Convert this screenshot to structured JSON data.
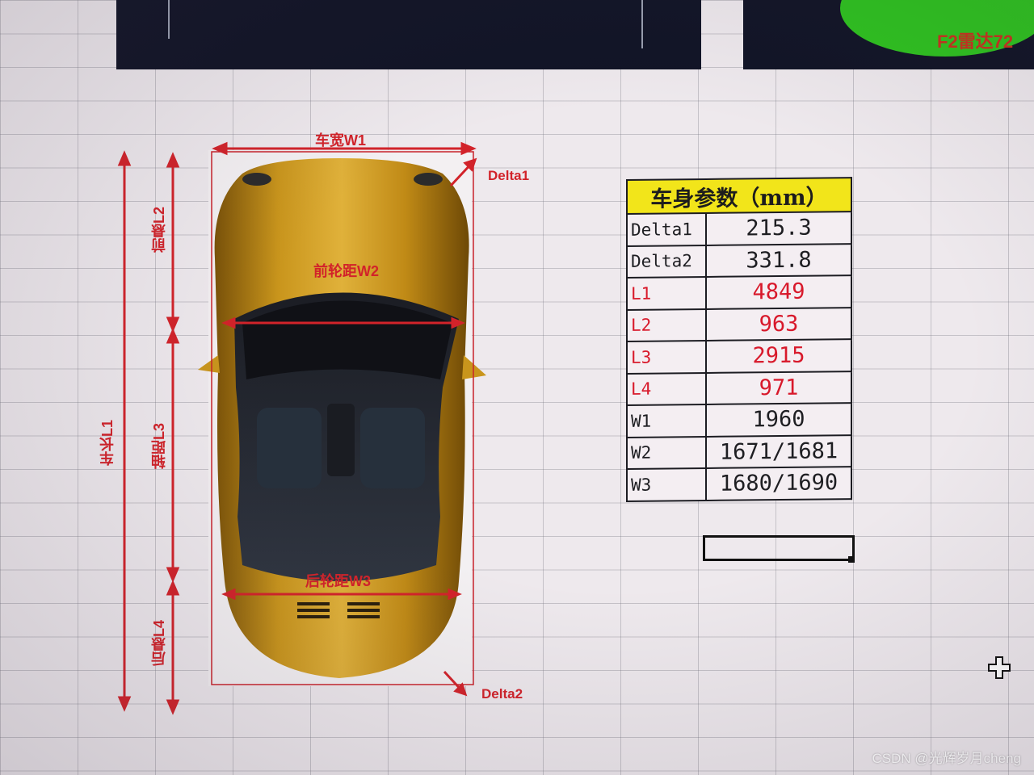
{
  "top_panels": {
    "radar_label": "F2雷达72"
  },
  "car_diagram": {
    "width_label": "车宽W1",
    "front_track_label": "前轮距W2",
    "rear_track_label": "后轮距W3",
    "length_label": "车长L1",
    "front_overhang_label": "前悬L2",
    "wheelbase_label": "轴距L3",
    "rear_overhang_label": "后悬L4",
    "delta1_label": "Delta1",
    "delta2_label": "Delta2"
  },
  "params_table": {
    "header": "车身参数（mm）",
    "rows": [
      {
        "name": "Delta1",
        "value": "215.3",
        "highlight": false
      },
      {
        "name": "Delta2",
        "value": "331.8",
        "highlight": false
      },
      {
        "name": "L1",
        "value": "4849",
        "highlight": true
      },
      {
        "name": "L2",
        "value": "963",
        "highlight": true
      },
      {
        "name": "L3",
        "value": "2915",
        "highlight": true
      },
      {
        "name": "L4",
        "value": "971",
        "highlight": true
      },
      {
        "name": "W1",
        "value": "1960",
        "highlight": false
      },
      {
        "name": "W2",
        "value": "1671/1681",
        "highlight": false
      },
      {
        "name": "W3",
        "value": "1680/1690",
        "highlight": false
      }
    ]
  },
  "cursor_icon": "move-cross-icon",
  "watermark": "CSDN @光辉岁月cheng",
  "colors": {
    "dimension_red": "#d2232a",
    "header_yellow": "#f2e51a",
    "car_gold": "#c9951c",
    "radar_green": "#2ec21f"
  }
}
